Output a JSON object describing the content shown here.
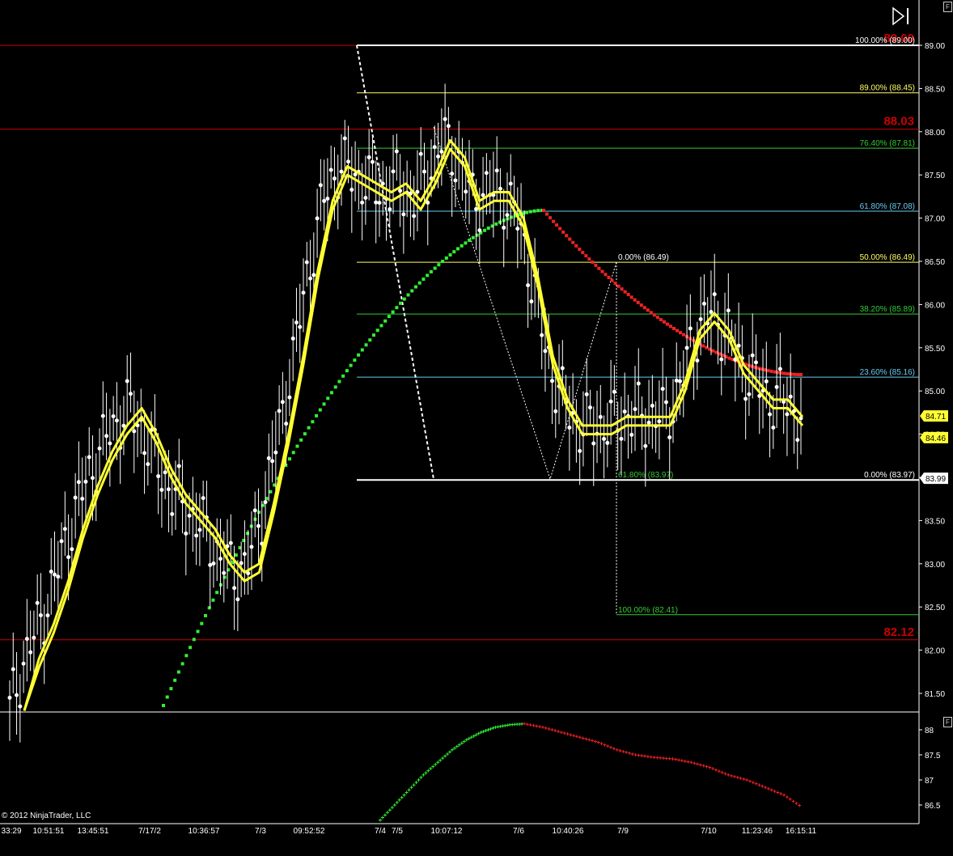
{
  "copyright": "© 2012 NinjaTrader, LLC",
  "panel_buttons": [
    "F",
    "F"
  ],
  "colors": {
    "background": "#000000",
    "fib_white": "#ffffff",
    "fib_yellow": "#ffff66",
    "fib_green": "#33cc33",
    "fib_cyan": "#66ccee",
    "support_resistance": "#cc0000",
    "moving_average": "#ffff33",
    "dots_up": "#33ee33",
    "dots_down": "#ee2222",
    "candles": "#ffffff"
  },
  "chart_data": [
    {
      "type": "line",
      "panel": "price",
      "ylim": [
        81.25,
        89.2
      ],
      "y_ticks": [
        "89.00",
        "88.50",
        "88.00",
        "87.50",
        "87.00",
        "86.50",
        "86.00",
        "85.50",
        "85.00",
        "84.50",
        "84.00",
        "83.50",
        "83.00",
        "82.50",
        "82.00",
        "81.50"
      ],
      "x_labels": [
        "33:29",
        "10:51:51",
        "13:45:51",
        "7/17/2",
        "10:36:57",
        "7/3",
        "09:52:52",
        "7/4",
        "7/5",
        "10:07:12",
        "7/6",
        "10:40:26",
        "7/9",
        "7/10",
        "11:23:46",
        "16:15:11"
      ],
      "horizontal_levels": [
        {
          "value": 89.0,
          "label": "89.00",
          "partial": true
        },
        {
          "value": 88.03,
          "label": "88.03"
        },
        {
          "value": 82.12,
          "label": "82.12"
        }
      ],
      "price_tags": [
        {
          "value": 84.71,
          "label": "84.71"
        },
        {
          "value": 84.46,
          "label": "84.46"
        },
        {
          "value": 83.99,
          "label": "83.99"
        }
      ],
      "fib_retracement_1": {
        "levels": [
          {
            "value": 89.0,
            "label": "100.00% (89.00)",
            "color": "white"
          },
          {
            "value": 88.45,
            "label": "89.00% (88.45)",
            "color": "yellow"
          },
          {
            "value": 87.81,
            "label": "76.40% (87.81)",
            "color": "green"
          },
          {
            "value": 87.08,
            "label": "61.80% (87.08)",
            "color": "cyan"
          },
          {
            "value": 86.49,
            "label": "50.00% (86.49)",
            "color": "yellow"
          },
          {
            "value": 85.89,
            "label": "38.20% (85.89)",
            "color": "green"
          },
          {
            "value": 85.16,
            "label": "23.60% (85.16)",
            "color": "cyan"
          },
          {
            "value": 83.97,
            "label": "0.00% (83.97)",
            "color": "white"
          }
        ]
      },
      "fib_extension_2": {
        "levels": [
          {
            "value": 86.49,
            "label": "0.00% (86.49)",
            "color": "white"
          },
          {
            "value": 83.97,
            "label": "61.80% (83.97)",
            "color": "green"
          },
          {
            "value": 82.41,
            "label": "100.00% (82.41)",
            "color": "green"
          }
        ]
      },
      "series": [
        {
          "values": [
            81.3,
            81.9,
            82.3,
            82.8,
            83.4,
            83.9,
            84.3,
            84.6,
            84.8,
            84.5,
            84.1,
            83.8,
            83.6,
            83.4,
            83.1,
            82.9,
            83.0,
            83.7,
            84.5,
            85.4,
            86.4,
            87.2,
            87.6,
            87.5,
            87.4,
            87.3,
            87.4,
            87.2,
            87.5,
            87.9,
            87.7,
            87.2,
            87.3,
            87.3,
            87.0,
            86.3,
            85.4,
            84.9,
            84.6,
            84.6,
            84.6,
            84.7,
            84.7,
            84.7,
            84.7,
            85.1,
            85.7,
            85.9,
            85.7,
            85.3,
            85.1,
            84.9,
            84.9,
            84.7
          ]
        },
        {
          "values": [
            81.3,
            81.8,
            82.2,
            82.7,
            83.3,
            83.8,
            84.2,
            84.5,
            84.7,
            84.4,
            84.0,
            83.7,
            83.5,
            83.3,
            83.0,
            82.8,
            82.9,
            83.6,
            84.4,
            85.3,
            86.3,
            87.1,
            87.5,
            87.4,
            87.3,
            87.2,
            87.3,
            87.1,
            87.4,
            87.8,
            87.6,
            87.1,
            87.2,
            87.2,
            86.9,
            86.2,
            85.3,
            84.8,
            84.5,
            84.5,
            84.5,
            84.6,
            84.6,
            84.6,
            84.6,
            85.0,
            85.6,
            85.8,
            85.6,
            85.2,
            85.0,
            84.8,
            84.8,
            84.6
          ]
        }
      ]
    },
    {
      "type": "line",
      "panel": "indicator",
      "ylim": [
        86.25,
        88.2
      ],
      "y_ticks": [
        "88",
        "87.5",
        "87",
        "86.5"
      ],
      "series": [
        {
          "name": "",
          "values": [
            86.2,
            86.5,
            86.8,
            87.1,
            87.35,
            87.6,
            87.8,
            87.95,
            88.05,
            88.1,
            88.12
          ]
        },
        {
          "name": "",
          "values": [
            88.12,
            88.05,
            87.95,
            87.85,
            87.75,
            87.6,
            87.5,
            87.45,
            87.42,
            87.35,
            87.25,
            87.1,
            87.0,
            86.85,
            86.7,
            86.45
          ]
        }
      ]
    }
  ]
}
